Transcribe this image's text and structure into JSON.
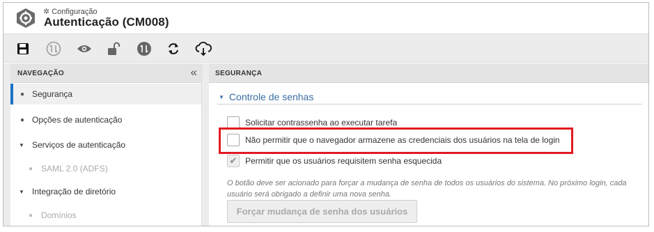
{
  "header": {
    "breadcrumb": "Configuração",
    "title": "Autenticação (CM008)"
  },
  "toolbar": {
    "buttons": [
      {
        "name": "save-icon"
      },
      {
        "name": "sync-disabled-icon"
      },
      {
        "name": "eye-icon"
      },
      {
        "name": "unlock-icon"
      },
      {
        "name": "sync-icon"
      },
      {
        "name": "refresh-icon"
      },
      {
        "name": "cloud-download-icon"
      }
    ]
  },
  "navigation": {
    "heading": "NAVEGAÇÃO",
    "items": [
      {
        "label": "Segurança",
        "type": "bullet",
        "active": true
      },
      {
        "label": "Opções de autenticação",
        "type": "bullet"
      },
      {
        "label": "Serviços de autenticação",
        "type": "caret"
      },
      {
        "label": "SAML 2.0 (ADFS)",
        "type": "sub"
      },
      {
        "label": "Integração de diretório",
        "type": "caret"
      },
      {
        "label": "Domínios",
        "type": "sub"
      }
    ]
  },
  "security": {
    "heading": "SEGURANÇA",
    "section_title": "Controle de senhas",
    "options": [
      {
        "label": "Solicitar contrassenha ao executar tarefa",
        "checked": false
      },
      {
        "label": "Não permitir que o navegador armazene as credenciais dos usuários na tela de login",
        "checked": false
      },
      {
        "label": "Permitir que os usuários requisitem senha esquecida",
        "checked": true
      }
    ],
    "note": "O botão deve ser acionado para forçar a mudança de senha de todos os usuários do sistema. No próximo login, cada usuário será obrigado a definir uma nova senha.",
    "force_button": "Forçar mudança de senha dos usuários"
  },
  "colors": {
    "accent": "#3a6ea5",
    "active_border": "#1a73c7",
    "highlight": "#e11b22"
  }
}
